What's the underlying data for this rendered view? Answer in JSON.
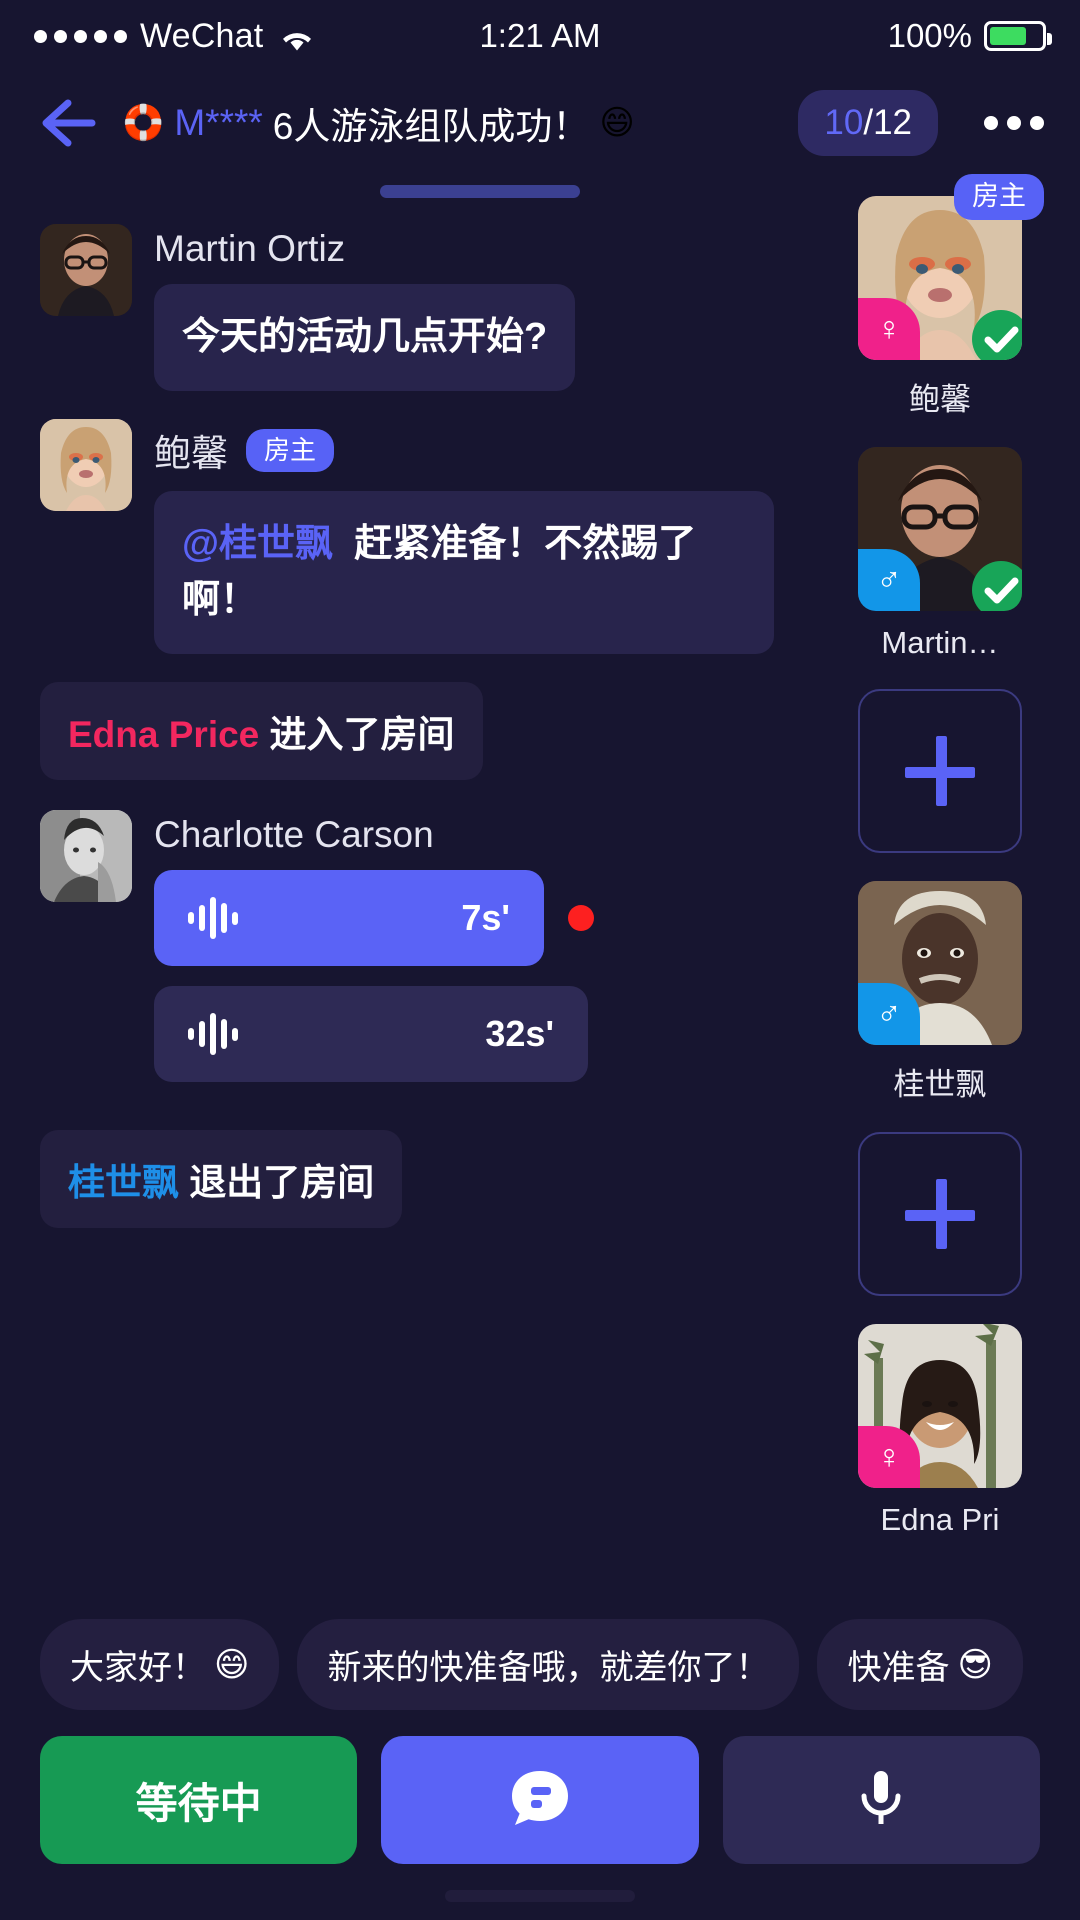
{
  "statusbar": {
    "signal_dots": 5,
    "carrier": "WeChat",
    "wifi_icon": "wifi-icon",
    "time": "1:21 AM",
    "battery_percent": "100%",
    "battery_level": 72,
    "battery_color": "#3ddc60"
  },
  "header": {
    "back_icon": "back-arrow-icon",
    "room_icon": "🛟",
    "title_prefix": "M****",
    "title_main": "6人游泳组队成功！",
    "title_emoji": "😄",
    "count_current": "10",
    "count_total": "/12",
    "more_icon": "more-dots-icon"
  },
  "messages": [
    {
      "kind": "text",
      "name": "Martin Ortiz",
      "is_host": false,
      "host_label": "",
      "avatar": "martin-avatar",
      "text": "今天的活动几点开始?"
    },
    {
      "kind": "text_mention",
      "name": "鲍馨",
      "is_host": true,
      "host_label": "房主",
      "avatar": "baoxin-avatar",
      "mention": "@桂世飘",
      "text": "赶紧准备！不然踢了啊！"
    },
    {
      "kind": "system",
      "name": "Edna Price",
      "name_color": "pink",
      "text": "进入了房间"
    },
    {
      "kind": "voice",
      "name": "Charlotte Carson",
      "avatar": "charlotte-avatar",
      "clips": [
        {
          "duration": "7s'",
          "unplayed": true
        },
        {
          "duration": "32s'",
          "unplayed": false
        }
      ]
    },
    {
      "kind": "system",
      "name": "桂世飘",
      "name_color": "blue",
      "text": "退出了房间"
    }
  ],
  "rail": {
    "seats": [
      {
        "type": "member",
        "name": "鲍馨",
        "avatar": "baoxin-avatar",
        "gender": "female",
        "gender_icon": "♀",
        "host_badge": "房主",
        "ready": true
      },
      {
        "type": "member",
        "name": "Martin…",
        "avatar": "martin-avatar",
        "gender": "male",
        "gender_icon": "♂",
        "host_badge": "",
        "ready": true
      },
      {
        "type": "empty",
        "add_icon": "plus-icon"
      },
      {
        "type": "member",
        "name": "桂世飘",
        "avatar": "guishipiao-avatar",
        "gender": "male",
        "gender_icon": "♂",
        "host_badge": "",
        "ready": false
      },
      {
        "type": "empty",
        "add_icon": "plus-icon"
      },
      {
        "type": "member",
        "name": "Edna Pri",
        "avatar": "edna-avatar",
        "gender": "female",
        "gender_icon": "♀",
        "host_badge": "",
        "ready": false
      }
    ]
  },
  "quick_replies": [
    {
      "text": "大家好！",
      "emoji": "😄"
    },
    {
      "text": "新来的快准备哦，就差你了！",
      "emoji": ""
    },
    {
      "text": "快准备",
      "emoji": "😎"
    }
  ],
  "actions": {
    "wait_label": "等待中",
    "chat_icon": "chat-bubble-icon",
    "mic_icon": "microphone-icon"
  },
  "colors": {
    "bg": "#171530",
    "accent": "#5a63f6",
    "bubble": "#28244c",
    "system_bubble": "#231f3f",
    "pink": "#f2275f",
    "blue": "#1e8fe8",
    "green": "#179a54",
    "ready_green": "#18a558",
    "unread_red": "#fd2020",
    "female": "#f0218a",
    "male": "#1296e8"
  }
}
